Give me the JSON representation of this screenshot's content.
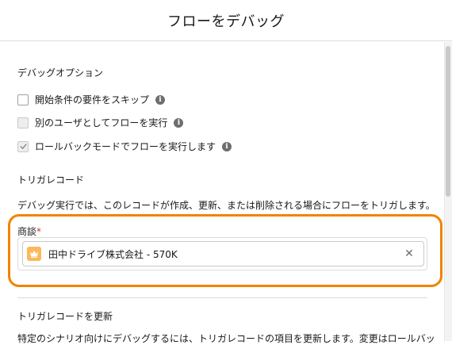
{
  "dialog": {
    "title": "フローをデバッグ"
  },
  "debug_options": {
    "heading": "デバッグオプション",
    "options": [
      {
        "label": "開始条件の要件をスキップ",
        "checked": false,
        "disabled": false,
        "info_icon": "info-icon"
      },
      {
        "label": "別のユーザとしてフローを実行",
        "checked": false,
        "disabled": true,
        "info_icon": "info-icon"
      },
      {
        "label": "ロールバックモードでフローを実行します",
        "checked": true,
        "disabled": true,
        "info_icon": "info-icon"
      }
    ]
  },
  "trigger_record": {
    "heading": "トリガレコード",
    "description": "デバッグ実行では、このレコードが作成、更新、または削除される場合にフローをトリガします。",
    "field_label": "商談",
    "required_marker": "*",
    "selected_record": "田中ドライブ株式会社 - 570K",
    "record_icon": "opportunity-crown-icon",
    "remove_icon": "close-icon"
  },
  "update_trigger_record": {
    "heading": "トリガレコードを更新",
    "description_partial": "特定のシナリオ向けにデバッグするには、トリガレコードの項目を更新します。変更はロールバッ"
  },
  "colors": {
    "highlight": "#f18300",
    "opportunity_icon_bg": "#fcb95b"
  }
}
